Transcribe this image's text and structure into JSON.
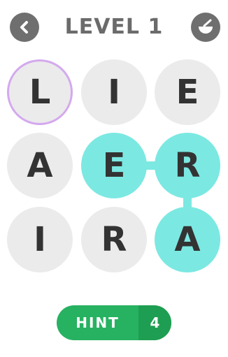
{
  "header": {
    "title": "LEVEL 1",
    "back_icon": "chevron-left-icon",
    "shop_icon": "bowl-icon"
  },
  "board": {
    "rows": [
      [
        {
          "letter": "L",
          "state": "hinted"
        },
        {
          "letter": "I",
          "state": "normal"
        },
        {
          "letter": "E",
          "state": "normal"
        }
      ],
      [
        {
          "letter": "A",
          "state": "normal"
        },
        {
          "letter": "E",
          "state": "selected"
        },
        {
          "letter": "R",
          "state": "selected"
        }
      ],
      [
        {
          "letter": "I",
          "state": "normal"
        },
        {
          "letter": "R",
          "state": "normal"
        },
        {
          "letter": "A",
          "state": "selected"
        }
      ]
    ]
  },
  "hint": {
    "label": "HINT",
    "count": "4"
  },
  "colors": {
    "tile": "#ebebeb",
    "selected": "#7ce8e2",
    "hint_outline": "#d4a9ee",
    "hint_button": "#27b261",
    "hint_count_bg": "#1e9e52",
    "header_text": "#6b6b6b",
    "letter": "#333333"
  }
}
